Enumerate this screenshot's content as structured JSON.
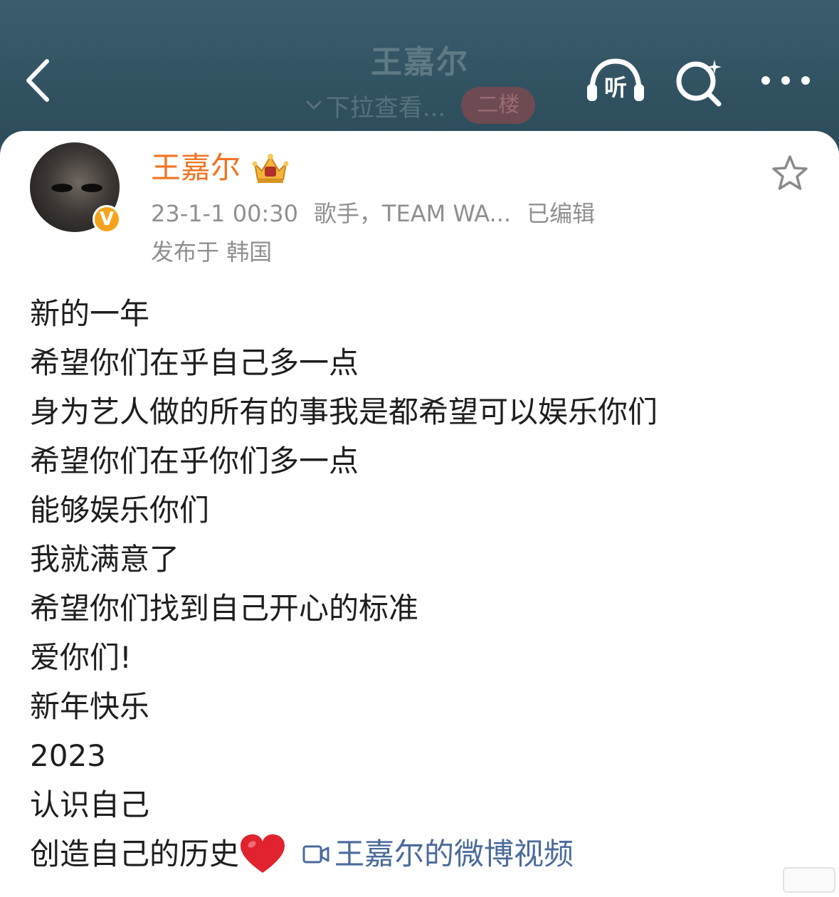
{
  "header": {
    "title": "王嘉尔",
    "pull_hint": "下拉查看...",
    "floor_badge": "二楼",
    "listen_label": "听"
  },
  "post": {
    "author": "王嘉尔",
    "verified_mark": "V",
    "timestamp": "23-1-1 00:30",
    "source": "歌手，TEAM WA...",
    "edited": "已编辑",
    "location": "发布于 韩国",
    "lines": [
      "新的一年",
      "希望你们在乎自己多一点",
      "身为艺人做的所有的事我是都希望可以娱乐你们",
      "希望你们在乎你们多一点",
      "能够娱乐你们",
      "我就满意了",
      "希望你们找到自己开心的标准",
      "爱你们!",
      "新年快乐",
      "2023",
      "认识自己"
    ],
    "last_line_text": "创造自己的历史",
    "video_link_label": "王嘉尔的微博视频"
  },
  "colors": {
    "header_bg": "#2f4f5e",
    "username": "#f07422",
    "meta": "#8f8f8f",
    "link": "#4b6a9b",
    "verified": "#f4a41c"
  },
  "icons": [
    "back-arrow-icon",
    "listen-icon",
    "search-icon",
    "more-icon",
    "crown-badge-icon",
    "star-icon",
    "heart-icon",
    "video-icon"
  ]
}
